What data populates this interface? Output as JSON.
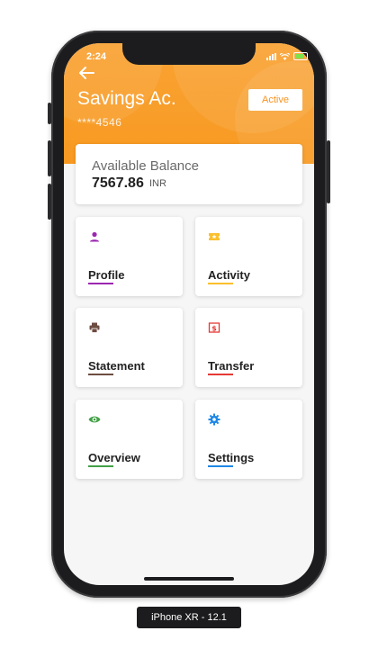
{
  "status_bar": {
    "time": "2:24"
  },
  "header": {
    "title": "Savings Ac.",
    "account_number": "****4546",
    "status_button_label": "Active"
  },
  "balance": {
    "label": "Available Balance",
    "amount": "7567.86",
    "currency": "INR"
  },
  "tiles": [
    {
      "label": "Profile",
      "icon": "person-icon",
      "color": "#9c27b0"
    },
    {
      "label": "Activity",
      "icon": "ticket-icon",
      "color": "#fbc02d"
    },
    {
      "label": "Statement",
      "icon": "printer-icon",
      "color": "#6d4c41"
    },
    {
      "label": "Transfer",
      "icon": "dollar-icon",
      "color": "#e53935"
    },
    {
      "label": "Overview",
      "icon": "eye-icon",
      "color": "#43a047"
    },
    {
      "label": "Settings",
      "icon": "gear-icon",
      "color": "#1e88e5"
    }
  ],
  "device_label": "iPhone XR - 12.1",
  "colors": {
    "header": "#f89a22",
    "active_text": "#f7931e"
  }
}
